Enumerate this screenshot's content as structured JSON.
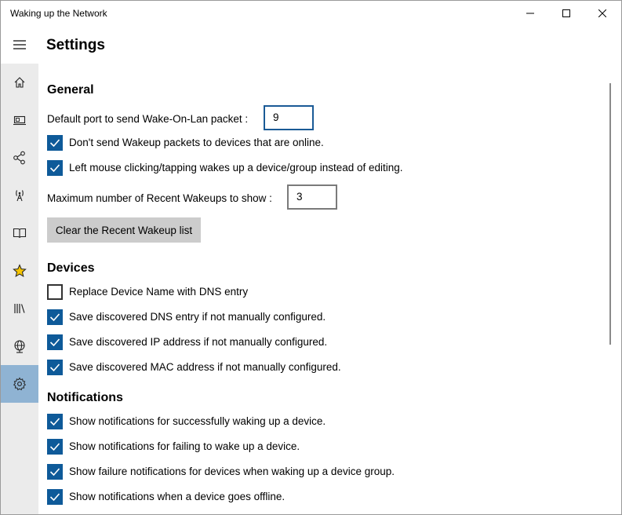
{
  "window": {
    "title": "Waking up the Network"
  },
  "header": {
    "page_title": "Settings"
  },
  "nav": {
    "items": [
      {
        "icon": "home-icon"
      },
      {
        "icon": "device-icon"
      },
      {
        "icon": "group-icon"
      },
      {
        "icon": "antenna-icon"
      },
      {
        "icon": "book-icon"
      },
      {
        "icon": "star-icon",
        "color": "#f5c400"
      },
      {
        "icon": "library-icon"
      },
      {
        "icon": "globe-icon"
      },
      {
        "icon": "gear-icon",
        "selected": true
      }
    ],
    "selected_color": "#8fb3d3"
  },
  "general": {
    "title": "General",
    "port_label": "Default port to send Wake-On-Lan packet :",
    "port_value": "9",
    "skip_online_label": "Don't send Wakeup packets to devices that are online.",
    "skip_online_checked": true,
    "click_wakes_label": "Left mouse clicking/tapping wakes up a device/group instead of editing.",
    "click_wakes_checked": true,
    "recent_label": "Maximum number of Recent Wakeups to show :",
    "recent_value": "3",
    "clear_button": "Clear the Recent Wakeup list"
  },
  "devices": {
    "title": "Devices",
    "options": [
      {
        "label": "Replace Device Name with DNS entry",
        "checked": false
      },
      {
        "label": "Save discovered DNS entry if not manually configured.",
        "checked": true
      },
      {
        "label": "Save discovered IP address if not manually configured.",
        "checked": true
      },
      {
        "label": "Save discovered MAC address if not manually configured.",
        "checked": true
      }
    ]
  },
  "notifications": {
    "title": "Notifications",
    "options": [
      {
        "label": "Show notifications for successfully waking up a device.",
        "checked": true
      },
      {
        "label": "Show notifications for failing to wake up a device.",
        "checked": true
      },
      {
        "label": "Show failure notifications for devices when waking up a device group.",
        "checked": true
      },
      {
        "label": "Show notifications when a device goes offline.",
        "checked": true
      }
    ]
  },
  "colors": {
    "accent": "#0e5a99",
    "button_bg": "#cccccc",
    "nav_bg": "#ebebeb"
  }
}
